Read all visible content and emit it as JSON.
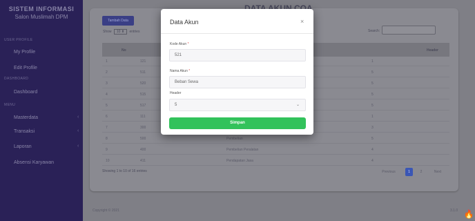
{
  "sidebar": {
    "brand_line1": "SISTEM INFORMASI",
    "brand_line2": "Salon Muslimah DPM",
    "sections": [
      {
        "title": "USER PROFILE"
      },
      {
        "title": "DASHBOARD"
      },
      {
        "title": "MENU"
      }
    ],
    "items": [
      {
        "label": "My Profile"
      },
      {
        "label": "Edit Profile"
      },
      {
        "label": "Dashboard"
      },
      {
        "label": "Masterdata",
        "caret": "‹"
      },
      {
        "label": "Transaksi",
        "caret": "‹"
      },
      {
        "label": "Laporan",
        "caret": "‹"
      },
      {
        "label": "Absensi Karyawan"
      }
    ]
  },
  "page": {
    "title": "DATA AKUN COA",
    "add_button": "Tambah Data",
    "show_label": "Show",
    "show_value": "10",
    "entries_label": "entries",
    "search_label": "Search:"
  },
  "table": {
    "header": {
      "no": "No",
      "header": "Header"
    },
    "rows": [
      {
        "no": "1",
        "kode": "121",
        "nama": "",
        "header": "1"
      },
      {
        "no": "2",
        "kode": "511",
        "nama": "",
        "header": "5"
      },
      {
        "no": "3",
        "kode": "520",
        "nama": "",
        "header": "5"
      },
      {
        "no": "4",
        "kode": "515",
        "nama": "",
        "header": "5"
      },
      {
        "no": "5",
        "kode": "517",
        "nama": "",
        "header": "5"
      },
      {
        "no": "6",
        "kode": "111",
        "nama": "",
        "header": "1"
      },
      {
        "no": "7",
        "kode": "300",
        "nama": "",
        "header": "3"
      },
      {
        "no": "8",
        "kode": "500",
        "nama": "Pembelian",
        "header": "5"
      },
      {
        "no": "9",
        "kode": "400",
        "nama": "Pembelian Peralatan",
        "header": "4"
      },
      {
        "no": "10",
        "kode": "411",
        "nama": "Pendapatan Jasa",
        "header": "4"
      }
    ],
    "info": "Showing 1 to 10 of 16 entries"
  },
  "pagination": {
    "previous": "Previous",
    "pages": [
      "1",
      "2"
    ],
    "next": "Next"
  },
  "footer": {
    "copyright": "Copyright © 2021",
    "version": "3.1.0"
  },
  "modal": {
    "title": "Data Akun",
    "close": "×",
    "kode_label": "Kode Akun",
    "kode_value": "521",
    "nama_label": "Nama Akun",
    "nama_value": "Beban Sewa",
    "header_label": "Header",
    "header_value": "5",
    "required_mark": "*",
    "save_button": "Simpan"
  },
  "colors": {
    "sidebar": "#2a2157",
    "primary": "#3a3f85",
    "success": "#32c25b",
    "page_active": "#3a56b5"
  },
  "icons": {
    "fire": "fire-icon",
    "chevron": "chevron-down-icon"
  }
}
